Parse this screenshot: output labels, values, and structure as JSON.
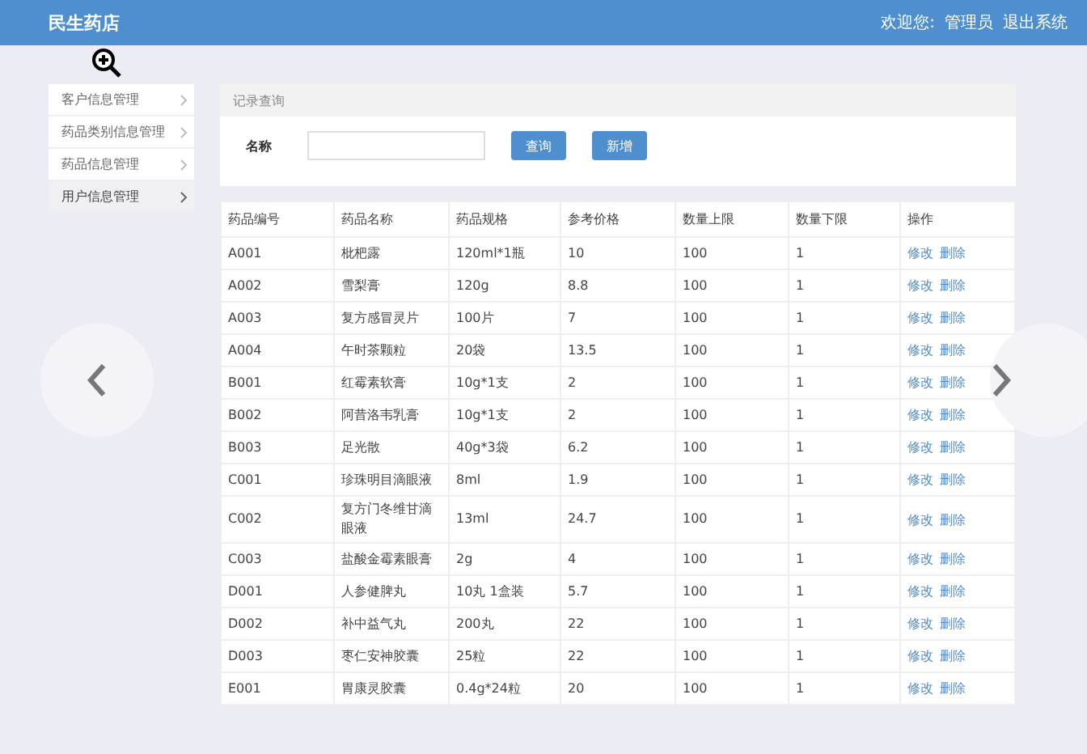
{
  "header": {
    "title": "民生药店",
    "welcome": "欢迎您:",
    "user": "管理员",
    "logout": "退出系统"
  },
  "sidebar": {
    "items": [
      {
        "label": "客户信息管理",
        "selected": false
      },
      {
        "label": "药品类别信息管理",
        "selected": false
      },
      {
        "label": "药品信息管理",
        "selected": false
      },
      {
        "label": "用户信息管理",
        "selected": true
      }
    ]
  },
  "search_panel": {
    "title": "记录查询",
    "field_label": "名称",
    "buttons": [
      "查询",
      "新增"
    ]
  },
  "table": {
    "columns": [
      "药品编号",
      "药品名称",
      "药品规格",
      "参考价格",
      "数量上限",
      "数量下限",
      "操作"
    ],
    "rows": [
      {
        "cells": [
          "A001",
          "枇杷露",
          "120ml*1瓶",
          "10",
          "100",
          "1"
        ],
        "actions": [
          "修改",
          "删除"
        ]
      },
      {
        "cells": [
          "A002",
          "雪梨膏",
          "120g",
          "8.8",
          "100",
          "1"
        ],
        "actions": [
          "修改",
          "删除"
        ]
      },
      {
        "cells": [
          "A003",
          "复方感冒灵片",
          "100片",
          "7",
          "100",
          "1"
        ],
        "actions": [
          "修改",
          "删除"
        ]
      },
      {
        "cells": [
          "A004",
          "午时茶颗粒",
          "20袋",
          "13.5",
          "100",
          "1"
        ],
        "actions": [
          "修改",
          "删除"
        ]
      },
      {
        "cells": [
          "B001",
          "红霉素软膏",
          "10g*1支",
          "2",
          "100",
          "1"
        ],
        "actions": [
          "修改",
          "删除"
        ]
      },
      {
        "cells": [
          "B002",
          "阿昔洛韦乳膏",
          "10g*1支",
          "2",
          "100",
          "1"
        ],
        "actions": [
          "修改",
          "删除"
        ]
      },
      {
        "cells": [
          "B003",
          "足光散",
          "40g*3袋",
          "6.2",
          "100",
          "1"
        ],
        "actions": [
          "修改",
          "删除"
        ]
      },
      {
        "cells": [
          "C001",
          "珍珠明目滴眼液",
          "8ml",
          "1.9",
          "100",
          "1"
        ],
        "actions": [
          "修改",
          "删除"
        ]
      },
      {
        "cells": [
          "C002",
          "复方门冬维甘滴眼液",
          "13ml",
          "24.7",
          "100",
          "1"
        ],
        "actions": [
          "修改",
          "删除"
        ]
      },
      {
        "cells": [
          "C003",
          "盐酸金霉素眼膏",
          "2g",
          "4",
          "100",
          "1"
        ],
        "actions": [
          "修改",
          "删除"
        ]
      },
      {
        "cells": [
          "D001",
          "人参健脾丸",
          "10丸 1盒装",
          "5.7",
          "100",
          "1"
        ],
        "actions": [
          "修改",
          "删除"
        ]
      },
      {
        "cells": [
          "D002",
          "补中益气丸",
          "200丸",
          "22",
          "100",
          "1"
        ],
        "actions": [
          "修改",
          "删除"
        ]
      },
      {
        "cells": [
          "D003",
          "枣仁安神胶囊",
          "25粒",
          "22",
          "100",
          "1"
        ],
        "actions": [
          "修改",
          "删除"
        ]
      },
      {
        "cells": [
          "E001",
          "胃康灵胶囊",
          "0.4g*24粒",
          "20",
          "100",
          "1"
        ],
        "actions": [
          "修改",
          "删除"
        ]
      }
    ]
  }
}
